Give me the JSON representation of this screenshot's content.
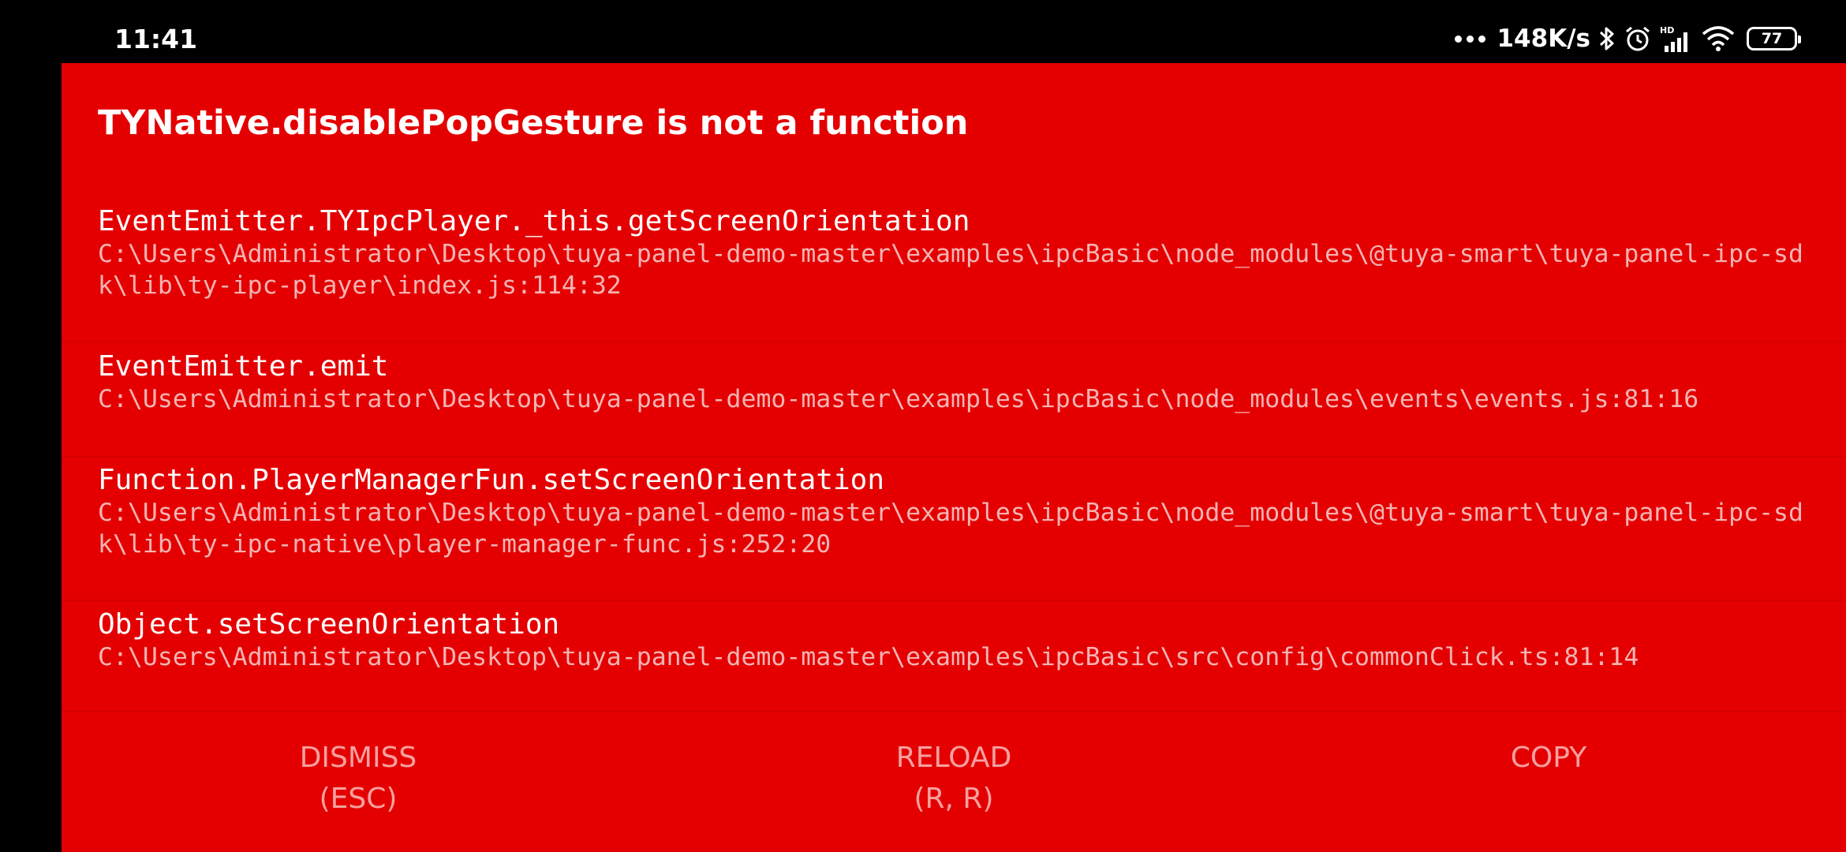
{
  "status_bar": {
    "time": "11:41",
    "network_speed": "148K/s",
    "battery_level": "77",
    "icons": [
      "more-dots-icon",
      "bluetooth-icon",
      "alarm-icon",
      "hd-signal-icon",
      "wifi-icon",
      "battery-icon"
    ]
  },
  "error": {
    "title": "TYNative.disablePopGesture is not a function"
  },
  "stack": [
    {
      "name": "EventEmitter.TYIpcPlayer._this.getScreenOrientation",
      "path": "C:\\Users\\Administrator\\Desktop\\tuya-panel-demo-master\\examples\\ipcBasic\\node_modules\\@tuya-smart\\tuya-panel-ipc-sdk\\lib\\ty-ipc-player\\index.js:114:32"
    },
    {
      "name": "EventEmitter.emit",
      "path": "C:\\Users\\Administrator\\Desktop\\tuya-panel-demo-master\\examples\\ipcBasic\\node_modules\\events\\events.js:81:16"
    },
    {
      "name": "Function.PlayerManagerFun.setScreenOrientation",
      "path": "C:\\Users\\Administrator\\Desktop\\tuya-panel-demo-master\\examples\\ipcBasic\\node_modules\\@tuya-smart\\tuya-panel-ipc-sdk\\lib\\ty-ipc-native\\player-manager-func.js:252:20"
    },
    {
      "name": "Object.setScreenOrientation",
      "path": "C:\\Users\\Administrator\\Desktop\\tuya-panel-demo-master\\examples\\ipcBasic\\src\\config\\commonClick.ts:81:14"
    }
  ],
  "buttons": {
    "dismiss": {
      "label": "DISMISS",
      "shortcut": "(ESC)"
    },
    "reload": {
      "label": "RELOAD",
      "shortcut": "(R, R)"
    },
    "copy": {
      "label": "COPY"
    }
  },
  "colors": {
    "background": "#e40000",
    "frame_path": "#f6b4b4",
    "button_text": "#f8a0a0"
  }
}
